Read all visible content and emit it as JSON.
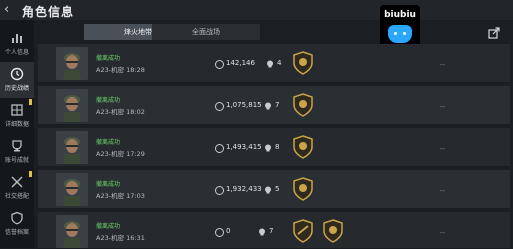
{
  "header": {
    "back_icon": "chevron-left-icon",
    "title": "角色信息"
  },
  "sidebar": {
    "items": [
      {
        "label": "个人信息",
        "icon": "bar-chart-icon",
        "active": false,
        "badge": false
      },
      {
        "label": "历史战绩",
        "icon": "clock-icon",
        "active": true,
        "badge": false
      },
      {
        "label": "详细数据",
        "icon": "grid-icon",
        "active": false,
        "badge": true
      },
      {
        "label": "账号成就",
        "icon": "trophy-icon",
        "active": false,
        "badge": false
      },
      {
        "label": "社交搭配",
        "icon": "crossed-swords-icon",
        "active": false,
        "badge": true
      },
      {
        "label": "信誉档案",
        "icon": "shield-icon",
        "active": false,
        "badge": false
      }
    ]
  },
  "tabs": [
    {
      "label": "烽火地带",
      "active": true
    },
    {
      "label": "全面战场",
      "active": false
    }
  ],
  "logo": {
    "text": "biubiu",
    "accent": "#2aa8ff"
  },
  "share_icon": "share-icon",
  "matches": [
    {
      "result": "撤离成功",
      "map_time": "A23-机密 18:28",
      "coins": "142,146",
      "kills": "4",
      "medals": 1,
      "extra": "--"
    },
    {
      "result": "撤离成功",
      "map_time": "A23-机密 18:02",
      "coins": "1,075,815",
      "kills": "7",
      "medals": 1,
      "extra": "--"
    },
    {
      "result": "撤离成功",
      "map_time": "A23-机密 17:29",
      "coins": "1,493,415",
      "kills": "8",
      "medals": 1,
      "extra": "--"
    },
    {
      "result": "撤离成功",
      "map_time": "A23-机密 17:03",
      "coins": "1,932,433",
      "kills": "5",
      "medals": 1,
      "extra": "--"
    },
    {
      "result": "撤离成功",
      "map_time": "A23-机密 16:31",
      "coins": "0",
      "kills": "7",
      "medals": 2,
      "extra": "--"
    }
  ],
  "colors": {
    "success": "#6ed26a",
    "gold": "#c9a44a",
    "row": "#262a2f"
  }
}
